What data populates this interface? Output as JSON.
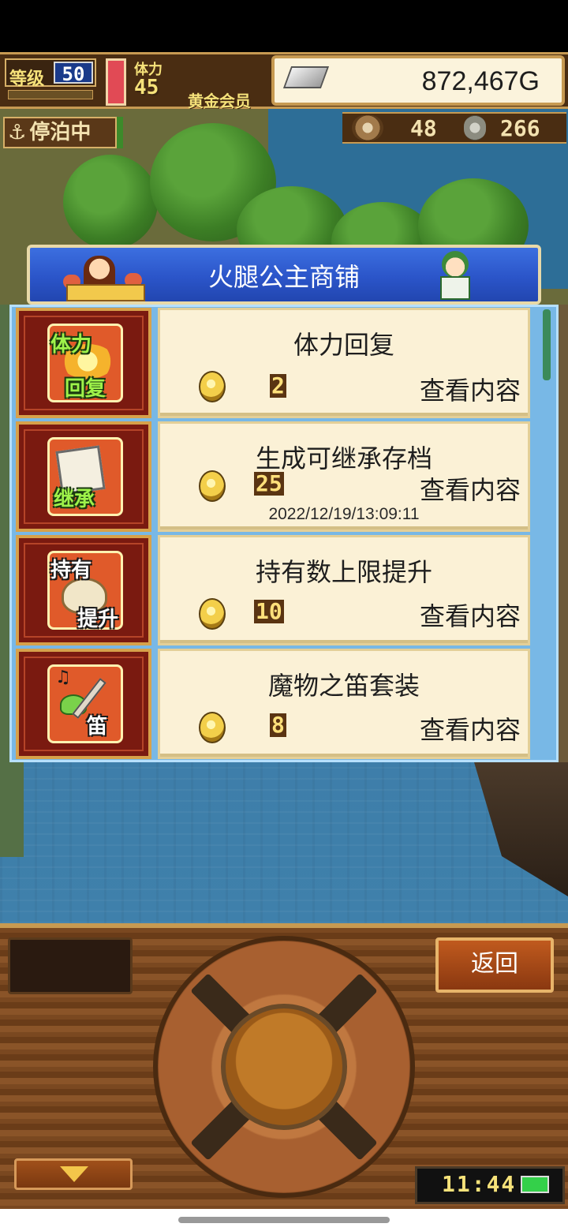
{
  "hud": {
    "level_label": "等级",
    "level_value": "50",
    "stamina_label": "体力",
    "stamina_value": "45",
    "member_label": "黄金会员",
    "money": "872,467G",
    "status_label": "停泊中",
    "resource1_value": "48",
    "resource2_value": "266",
    "accent_color": "#2b55c9",
    "icons": [
      "silver-bar-icon",
      "anchor-icon",
      "food-bowl-icon",
      "medal-icon"
    ]
  },
  "shop": {
    "title": "火腿公主商铺",
    "items": [
      {
        "name": "体力回复",
        "price": "2",
        "action": "查看内容",
        "icon_top": "体力",
        "icon_bottom": "回复",
        "icon": "stamina-recovery-icon"
      },
      {
        "name": "生成可继承存档",
        "price": "25",
        "action": "查看内容",
        "date": "2022/12/19/13:09:11",
        "icon_top": "继承",
        "icon": "inherit-save-icon"
      },
      {
        "name": "持有数上限提升",
        "price": "10",
        "action": "查看内容",
        "icon_top": "持有",
        "icon_bottom": "提升",
        "icon": "capacity-up-icon"
      },
      {
        "name": "魔物之笛套装",
        "price": "8",
        "action": "查看内容",
        "icon_top": "笛",
        "icon": "monster-flute-icon"
      }
    ]
  },
  "controls": {
    "back_label": "返回",
    "clock": "11:44"
  }
}
